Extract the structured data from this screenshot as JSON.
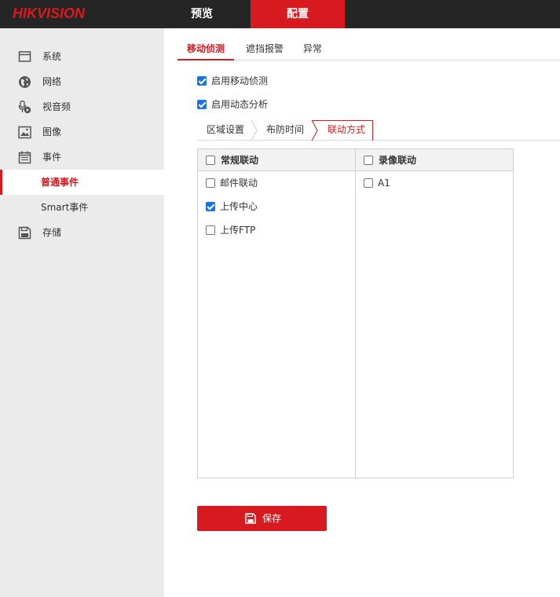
{
  "brand": {
    "logo_text_1": "HIK",
    "logo_text_2": "VISION",
    "accent": "#d71920"
  },
  "top_nav": {
    "preview": "预览",
    "config": "配置",
    "active": "config"
  },
  "sidebar": {
    "items": [
      {
        "label": "系统",
        "icon": "monitor-icon"
      },
      {
        "label": "网络",
        "icon": "globe-icon"
      },
      {
        "label": "视音频",
        "icon": "microphone-camera-icon"
      },
      {
        "label": "图像",
        "icon": "image-icon"
      },
      {
        "label": "事件",
        "icon": "calendar-icon"
      },
      {
        "label": "存储",
        "icon": "save-disk-icon"
      }
    ],
    "sub_items": [
      {
        "label": "普通事件",
        "active": true
      },
      {
        "label": "Smart事件",
        "active": false
      }
    ]
  },
  "subtabs": [
    "移动侦测",
    "遮挡报警",
    "异常"
  ],
  "options": {
    "enable_motion": {
      "label": "启用移动侦测",
      "checked": true
    },
    "enable_dynamic": {
      "label": "启用动态分析",
      "checked": true
    }
  },
  "steps": [
    "区域设置",
    "布防时间",
    "联动方式"
  ],
  "linkage": {
    "normal": {
      "header": "常规联动",
      "items": [
        {
          "label": "邮件联动",
          "checked": false
        },
        {
          "label": "上传中心",
          "checked": true
        },
        {
          "label": "上传FTP",
          "checked": false
        }
      ]
    },
    "record": {
      "header": "录像联动",
      "items": [
        {
          "label": "A1",
          "checked": false
        }
      ]
    }
  },
  "save_button": {
    "label": "保存",
    "icon": "save-icon"
  }
}
